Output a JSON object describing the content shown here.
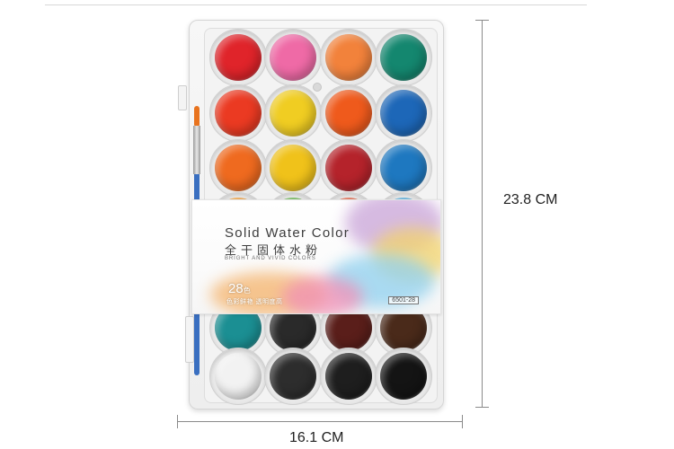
{
  "product": {
    "brand_en": "Solid Water Color",
    "brand_cn": "全干固体水粉",
    "tagline": "BRIGHT AND VIVID COLORS",
    "count_number": "28",
    "count_unit": "色",
    "tagline_cn": "色彩鲜艳 透明度高",
    "model": "6501-28"
  },
  "dimensions": {
    "height_label": "23.8 CM",
    "width_label": "16.1 CM"
  },
  "colors": {
    "top_rows": [
      [
        "#e0242a",
        "#ef6aa6",
        "#f2823b",
        "#14876f"
      ],
      [
        "#eb3a22",
        "#f0cd22",
        "#ef5a1c",
        "#1d67b8"
      ],
      [
        "#ef6a1f",
        "#f0c21a",
        "#b5232b",
        "#1e78c0"
      ]
    ],
    "partial_row": [
      "#f09a30",
      "#5fb145",
      "#e05a3a",
      "#47a7da"
    ],
    "bottom_rows": [
      [
        "#1b8f93",
        "#2a2a2a",
        "#5a1e1a",
        "#4a2a1a"
      ],
      [
        "#f2f2f2",
        "#2d2d2d",
        "#1e1e1e",
        "#141414"
      ]
    ]
  },
  "icons": [
    "paintbrush-icon"
  ]
}
